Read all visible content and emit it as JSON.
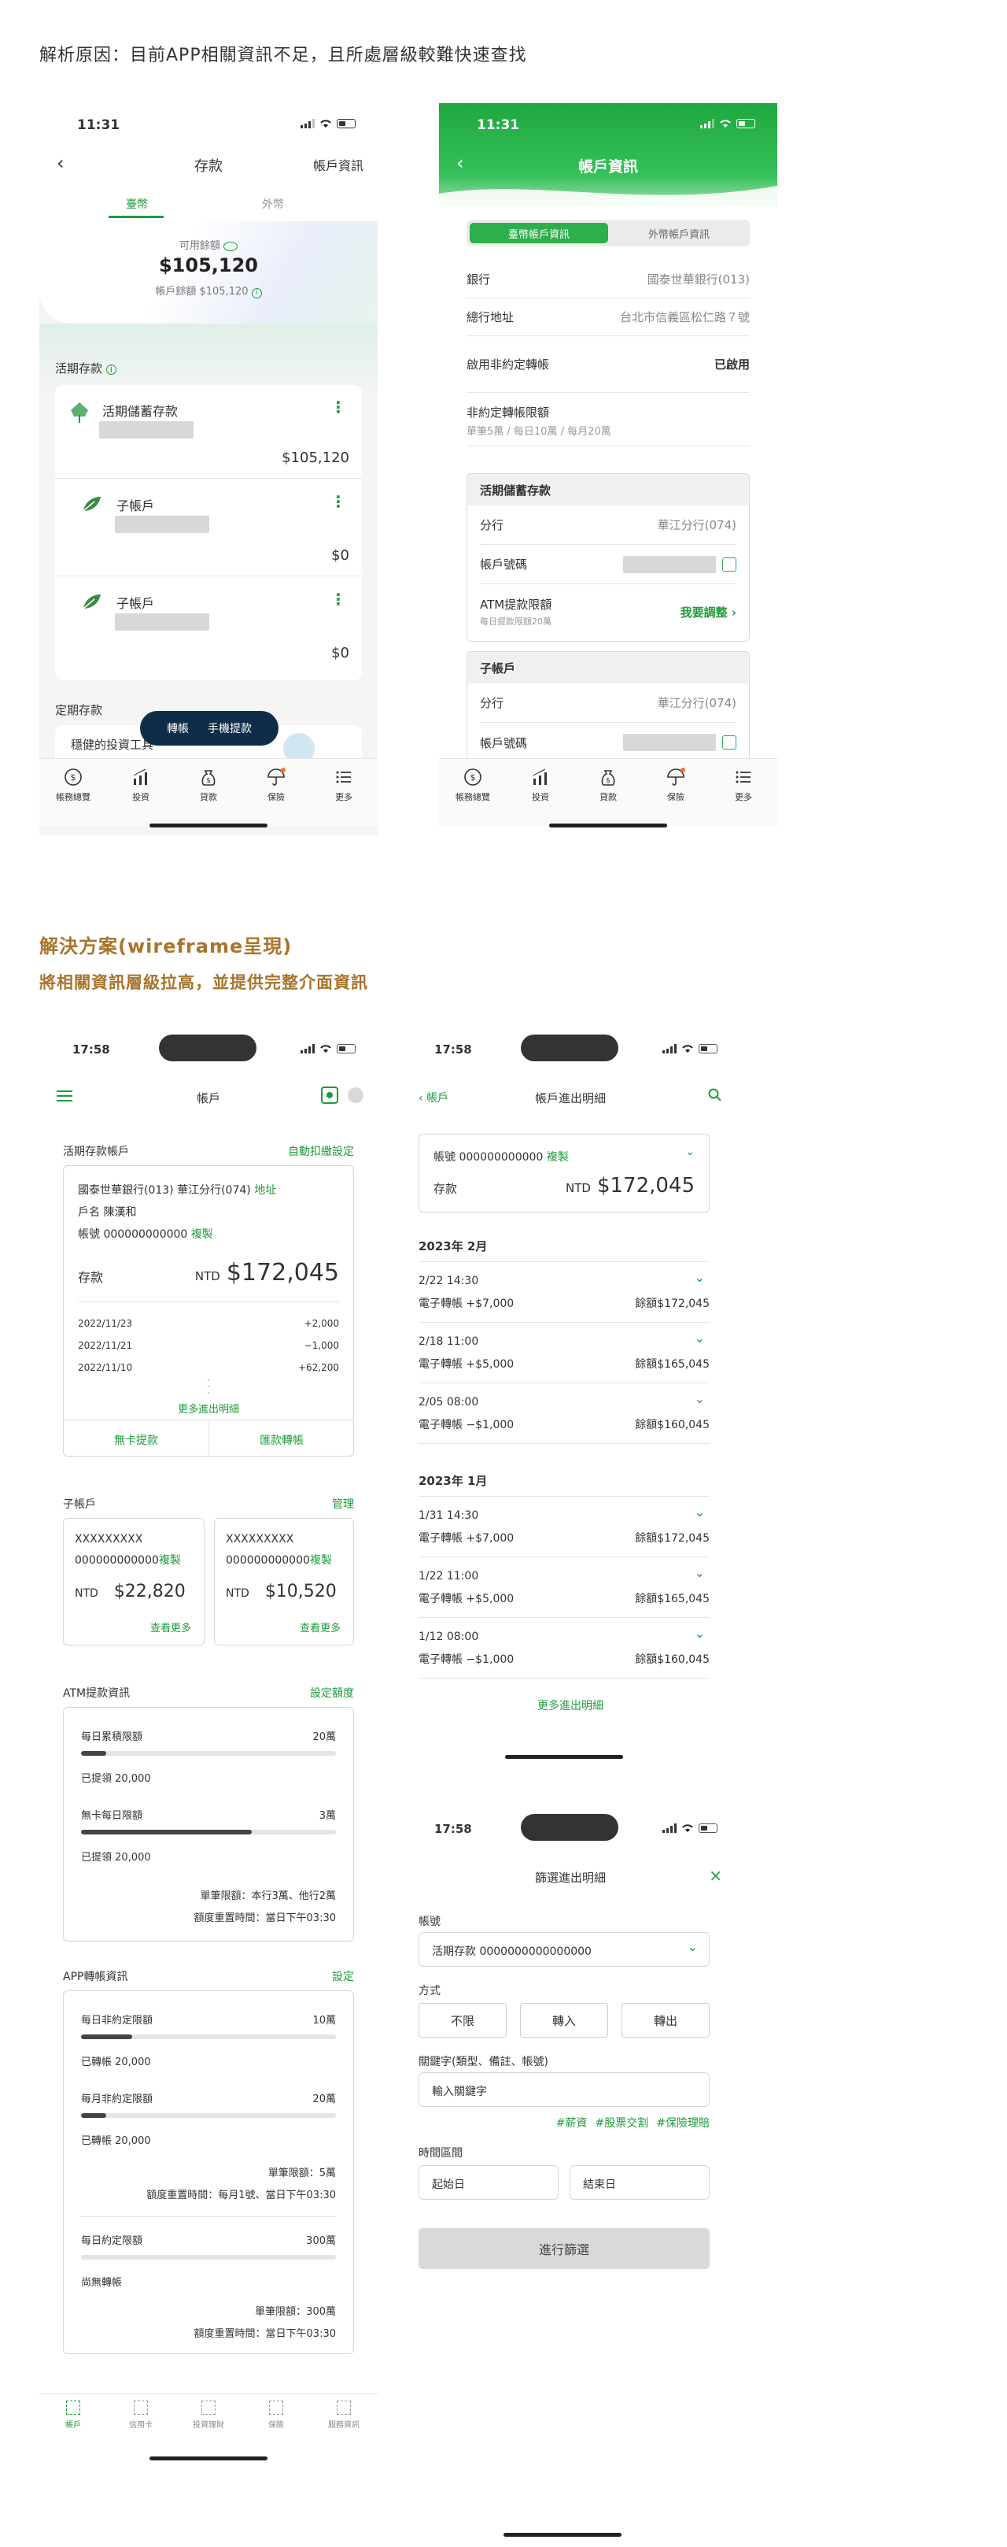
{
  "section1": {
    "heading": "解析原因：目前APP相關資訊不足，且所處層級較難快速查找"
  },
  "section2": {
    "heading": "解決方案(wireframe呈現)",
    "subheading": "將相關資訊層級拉高，並提供完整介面資訊"
  },
  "phoneA": {
    "time": "11:31",
    "title": "存款",
    "right_action": "帳戶資訊",
    "tabs": [
      "臺幣",
      "外幣"
    ],
    "available_label": "可用餘額",
    "available_amount": "$105,120",
    "balance_line": "帳戶餘額 $105,120",
    "demand_section": "活期存款",
    "accounts": [
      {
        "name": "活期儲蓄存款",
        "amount": "$105,120"
      },
      {
        "name": "子帳戶",
        "amount": "$0"
      },
      {
        "name": "子帳戶",
        "amount": "$0"
      }
    ],
    "fixed_section": "定期存款",
    "promo": "穩健的投資工具",
    "float_actions": [
      "轉帳",
      "手機提款"
    ],
    "nav": [
      "帳務總覽",
      "投資",
      "貸款",
      "保險",
      "更多"
    ]
  },
  "phoneB": {
    "time": "11:31",
    "title": "帳戶資訊",
    "seg": [
      "臺幣帳戶資訊",
      "外幣帳戶資訊"
    ],
    "rows": [
      {
        "label": "銀行",
        "value": "國泰世華銀行(013)"
      },
      {
        "label": "總行地址",
        "value": "台北市信義區松仁路７號"
      },
      {
        "label": "啟用非約定轉帳",
        "value": "已啟用"
      }
    ],
    "nonagreed_title": "非約定轉帳限額",
    "nonagreed_sub": "單筆5萬 / 每日10萬 / 每月20萬",
    "box1_title": "活期儲蓄存款",
    "box1_rows": [
      {
        "label": "分行",
        "value": "華江分行(074)"
      },
      {
        "label": "帳戶號碼",
        "value": ""
      }
    ],
    "atm_label": "ATM提款限額",
    "atm_sub": "每日提款限額20萬",
    "atm_action": "我要調整",
    "box2_title": "子帳戶",
    "box2_rows": [
      {
        "label": "分行",
        "value": "華江分行(074)"
      },
      {
        "label": "帳戶號碼",
        "value": ""
      }
    ],
    "nav": [
      "帳務總覽",
      "投資",
      "貸款",
      "保險",
      "更多"
    ]
  },
  "wfA": {
    "time": "17:58",
    "title": "帳戶",
    "demand_title": "活期存款帳戶",
    "demand_action": "自動扣繳設定",
    "bank_line": "國泰世華銀行(013) 華江分行(074)",
    "address_link": "地址",
    "owner": "戶名 陳漢和",
    "acct_no": "帳號 000000000000",
    "copy": "複製",
    "deposit_label": "存款",
    "currency": "NTD",
    "deposit_amount": "$172,045",
    "tx": [
      {
        "date": "2022/11/23",
        "amt": "+2,000"
      },
      {
        "date": "2022/11/21",
        "amt": "−1,000"
      },
      {
        "date": "2022/11/10",
        "amt": "+62,200"
      }
    ],
    "more_tx": "更多進出明細",
    "btn_cardless": "無卡提款",
    "btn_transfer": "匯款轉帳",
    "sub_title": "子帳戶",
    "sub_action": "管理",
    "subs": [
      {
        "name": "XXXXXXXXX",
        "no": "000000000000",
        "amount": "$22,820"
      },
      {
        "name": "XXXXXXXXX",
        "no": "000000000000",
        "amount": "$10,520"
      }
    ],
    "see_more": "查看更多",
    "atm_title": "ATM提款資訊",
    "atm_action": "設定額度",
    "atm_rows": [
      {
        "label": "每日累積限額",
        "limit": "20萬",
        "used": "已提領 20,000",
        "fill": 0.1
      },
      {
        "label": "無卡每日限額",
        "limit": "3萬",
        "used": "已提領 20,000",
        "fill": 0.67
      }
    ],
    "atm_note1": "單筆限額：本行3萬、他行2萬",
    "atm_note2": "額度重置時間：當日下午03:30",
    "app_title": "APP轉帳資訊",
    "app_action": "設定",
    "app_rows": [
      {
        "label": "每日非約定限額",
        "limit": "10萬",
        "used": "已轉帳 20,000",
        "fill": 0.2
      },
      {
        "label": "每月非約定限額",
        "limit": "20萬",
        "used": "已轉帳 20,000",
        "fill": 0.1
      }
    ],
    "app_note1": "單筆限額：5萬",
    "app_note2": "額度重置時間：每月1號、當日下午03:30",
    "agreed_label": "每日約定限額",
    "agreed_limit": "300萬",
    "agreed_used": "尚無轉帳",
    "agreed_fill": 0,
    "agreed_note1": "單筆限額：300萬",
    "agreed_note2": "額度重置時間：當日下午03:30",
    "nav": [
      "帳戶",
      "信用卡",
      "投資理財",
      "保險",
      "服務資訊"
    ]
  },
  "wfB": {
    "time": "17:58",
    "back": "帳戶",
    "title": "帳戶進出明細",
    "acct": "帳號 000000000000",
    "copy": "複製",
    "deposit_label": "存款",
    "currency": "NTD",
    "amount": "$172,045",
    "months": [
      {
        "label": "2023年 2月",
        "items": [
          {
            "dt": "2/22 14:30",
            "desc": "電子轉帳 +$7,000",
            "bal": "餘額$172,045"
          },
          {
            "dt": "2/18 11:00",
            "desc": "電子轉帳 +$5,000",
            "bal": "餘額$165,045"
          },
          {
            "dt": "2/05 08:00",
            "desc": "電子轉帳 −$1,000",
            "bal": "餘額$160,045"
          }
        ]
      },
      {
        "label": "2023年 1月",
        "items": [
          {
            "dt": "1/31 14:30",
            "desc": "電子轉帳 +$7,000",
            "bal": "餘額$172,045"
          },
          {
            "dt": "1/22 11:00",
            "desc": "電子轉帳 +$5,000",
            "bal": "餘額$165,045"
          },
          {
            "dt": "1/12 08:00",
            "desc": "電子轉帳 −$1,000",
            "bal": "餘額$160,045"
          }
        ]
      }
    ],
    "more": "更多進出明細"
  },
  "wfC": {
    "time": "17:58",
    "title": "篩選進出明細",
    "acct_label": "帳號",
    "acct_value": "活期存款 0000000000000000",
    "mode_label": "方式",
    "modes": [
      "不限",
      "轉入",
      "轉出"
    ],
    "kw_label": "關鍵字(類型、備註、帳號)",
    "kw_placeholder": "輸入關鍵字",
    "tags": [
      "#薪資",
      "#股票交割",
      "#保險理賠"
    ],
    "range_label": "時間區間",
    "start_placeholder": "起始日",
    "end_placeholder": "結束日",
    "submit": "進行篩選"
  }
}
